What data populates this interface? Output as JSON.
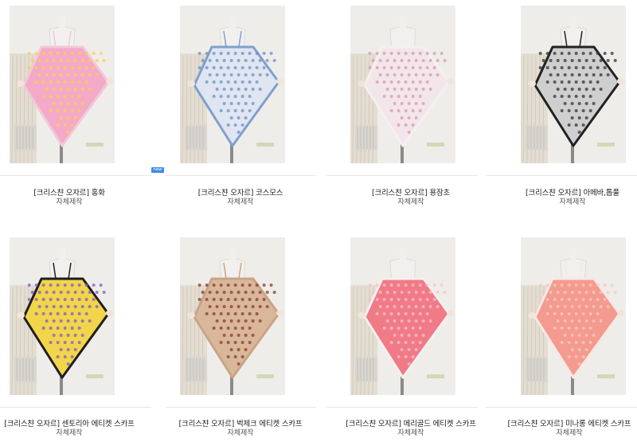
{
  "badge": {
    "new": "new"
  },
  "products": [
    {
      "name": "[크리스챤 오자르] 홍화",
      "sub": "자체제작",
      "scarf": "#f4a9c8",
      "accent": "#f7d24a",
      "trim": "#f0c8d8"
    },
    {
      "name": "[크리스챤 오자르] 코스모스",
      "sub": "자체제작",
      "scarf": "#dfe6f2",
      "accent": "#6f8fc0",
      "trim": "#7fa0cc"
    },
    {
      "name": "[크리스챤 오자르] 용잠초",
      "sub": "자체제작",
      "scarf": "#f3e6ea",
      "accent": "#d69aae",
      "trim": "#f4f0f0"
    },
    {
      "name": "[크리스챤 오자르] 아메바,톱풀",
      "sub": "자체제작",
      "scarf": "#cfcfcf",
      "accent": "#333333",
      "trim": "#222222"
    },
    {
      "name": "[크리스챤 오자르] 센토리아 에티켓 스카프",
      "sub": "자체제작",
      "scarf": "#f2d54a",
      "accent": "#7a5cc8",
      "trim": "#1e1e1e"
    },
    {
      "name": "[크리스챤 오자르] 벅체크 에티켓 스카프",
      "sub": "자체제작",
      "scarf": "#d9b79a",
      "accent": "#8a3a2c",
      "trim": "#c9a487"
    },
    {
      "name": "[크리스챤 오자르] 메리골드 에티켓 스카프",
      "sub": "자체제작",
      "scarf": "#f07a86",
      "accent": "#f7c2c8",
      "trim": "#f3f0f0"
    },
    {
      "name": "[크리스챤 오자르] 미나롱 에티켓 스카프",
      "sub": "자체제작",
      "scarf": "#f49a8e",
      "accent": "#f7c9c0",
      "trim": "#f6e8e4"
    }
  ]
}
